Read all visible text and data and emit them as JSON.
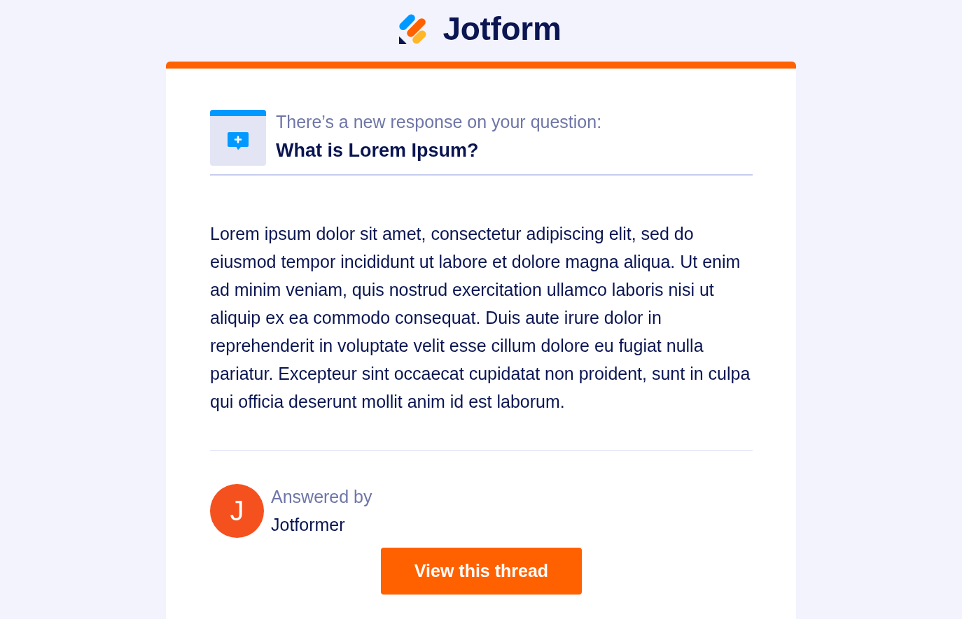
{
  "header": {
    "brand": "Jotform"
  },
  "notification": {
    "intro": "There’s a new response on your question:",
    "question": "What is Lorem Ipsum?"
  },
  "message": {
    "body": "Lorem ipsum dolor sit amet, consectetur adipiscing elit, sed do eiusmod tempor incididunt ut labore et dolore magna aliqua. Ut enim ad minim veniam, quis nostrud exercitation ullamco laboris nisi ut aliquip ex ea commodo consequat. Duis aute irure dolor in reprehenderit in voluptate velit esse cillum dolore eu fugiat nulla pariatur. Excepteur sint occaecat cupidatat non proident, sunt in culpa qui officia deserunt mollit anim id est laborum."
  },
  "author": {
    "initial": "J",
    "label": "Answered by",
    "name": "Jotformer"
  },
  "action_button": {
    "label": "View this thread"
  }
}
